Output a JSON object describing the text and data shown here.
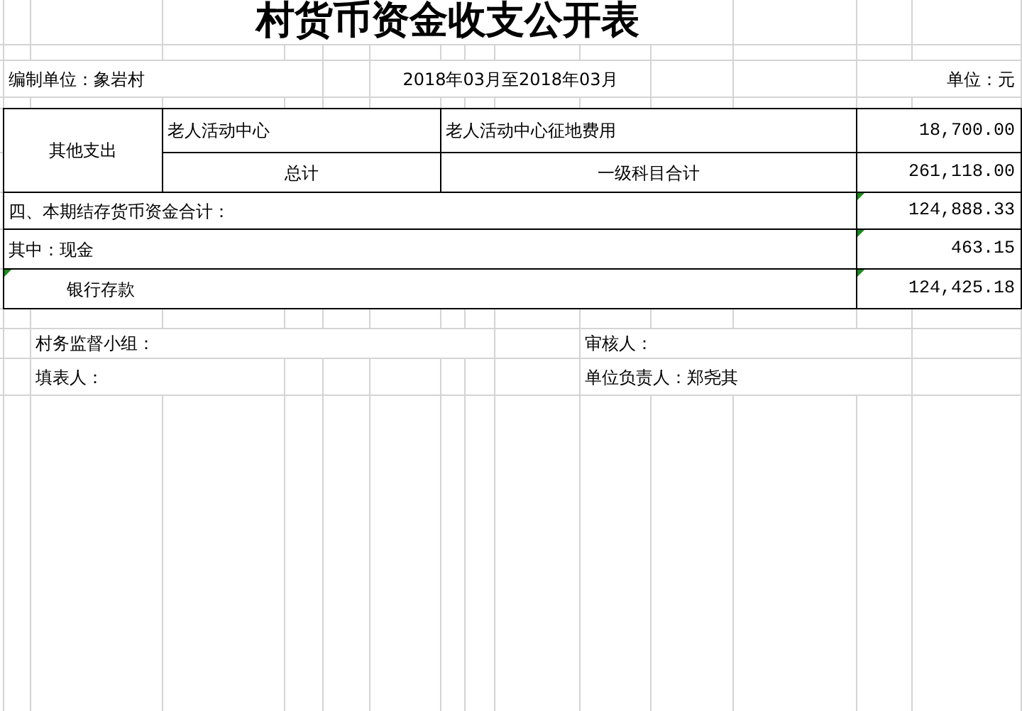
{
  "title": "村货币资金收支公开表",
  "header": {
    "unit_of_preparation": "编制单位：象岩村",
    "period": "2018年03月至2018年03月",
    "currency_unit": "单位：元"
  },
  "expense_group": {
    "label": "其他支出",
    "rows": [
      {
        "kind": "entry",
        "item": "老人活动中心",
        "detail": "老人活动中心征地费用",
        "amount": "18,700.00"
      },
      {
        "kind": "total",
        "item": "总计",
        "detail": "一级科目合计",
        "amount": "261,118.00"
      }
    ]
  },
  "balance_rows": [
    {
      "label": "四、本期结存货币资金合计：",
      "amount": "124,888.33",
      "indented": false,
      "label_flagged": false,
      "amount_flagged": true
    },
    {
      "label": "其中：现金",
      "amount": "463.15",
      "indented": false,
      "label_flagged": false,
      "amount_flagged": true
    },
    {
      "label": "银行存款",
      "amount": "124,425.18",
      "indented": true,
      "label_flagged": true,
      "amount_flagged": true
    }
  ],
  "signatures": [
    "村务监督小组：",
    "审核人：",
    "填表人：",
    "单位负责人：郑尧其"
  ]
}
